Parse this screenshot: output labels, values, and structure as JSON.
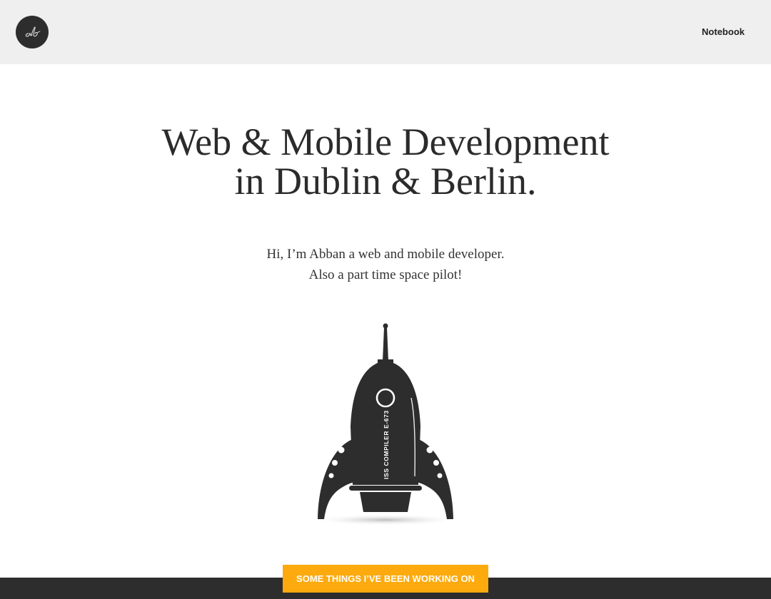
{
  "header": {
    "logo_icon": "ab-signature-logo",
    "nav": [
      {
        "label": "Notebook"
      }
    ]
  },
  "hero": {
    "title_line1": "Web & Mobile Development",
    "title_line2": "in Dublin & Berlin."
  },
  "intro": {
    "line1": "Hi, I’m Abban a web and mobile developer.",
    "line2": "Also a part time space pilot!"
  },
  "rocket": {
    "icon": "rocket-illustration",
    "label": "ISS COMPILER E-673"
  },
  "cta": {
    "label": "SOME THINGS I’VE BEEN WORKING ON"
  },
  "colors": {
    "header_bg": "#efefef",
    "dark": "#2d2d2d",
    "accent": "#fcaa0e"
  }
}
